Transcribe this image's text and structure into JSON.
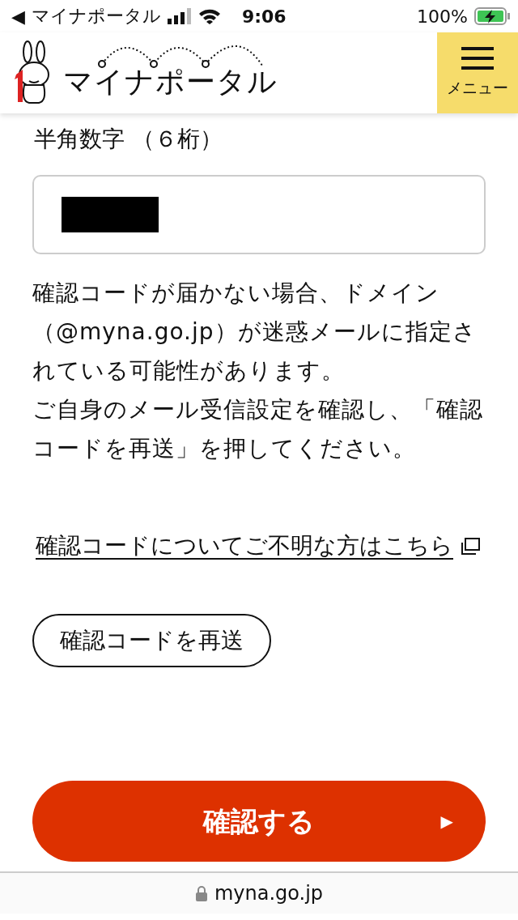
{
  "status_bar": {
    "back_glyph": "◀",
    "back_app": "マイナポータル",
    "time": "9:06",
    "battery": "100%",
    "charging": true
  },
  "header": {
    "logo_text": "マイナポータル",
    "menu_label": "メニュー"
  },
  "code_field": {
    "label": "半角数字 （６桁）",
    "value_redacted": true
  },
  "notice": [
    "確認コードが届かない場合、ドメイン（@myna.go.jp）が迷惑メールに指定されている可能性があります。",
    "ご自身のメール受信設定を確認し、「確認コードを再送」を押してください。"
  ],
  "help_link": {
    "text": "確認コードについてご不明な方はこちら",
    "external": true
  },
  "resend_button": "確認コードを再送",
  "confirm_button": {
    "label": "確認する",
    "arrow": "▶"
  },
  "address_bar": {
    "url": "myna.go.jp",
    "secure": true
  }
}
